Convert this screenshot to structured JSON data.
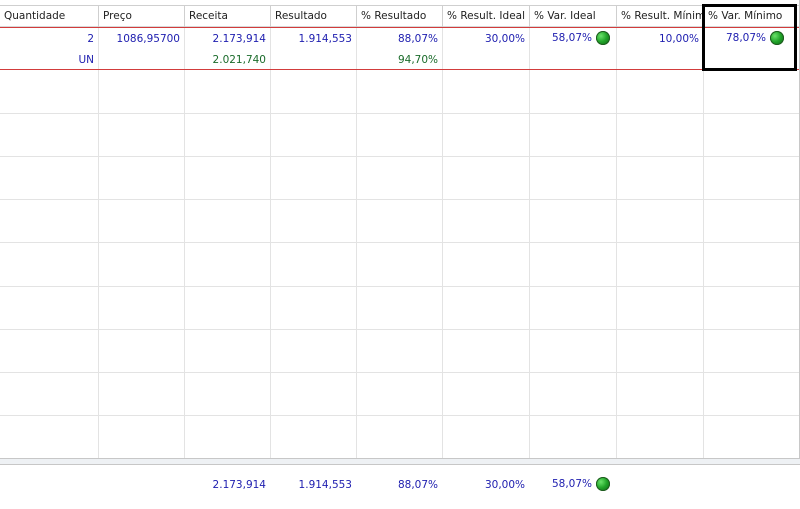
{
  "columns": [
    {
      "key": "qty",
      "label": "Quantidade"
    },
    {
      "key": "price",
      "label": "Preço"
    },
    {
      "key": "revenue",
      "label": "Receita"
    },
    {
      "key": "result",
      "label": "Resultado"
    },
    {
      "key": "pct_result",
      "label": "% Resultado"
    },
    {
      "key": "pct_ideal",
      "label": "% Result. Ideal"
    },
    {
      "key": "var_ideal",
      "label": "% Var. Ideal"
    },
    {
      "key": "pct_min",
      "label": "% Result. Mínimo"
    },
    {
      "key": "var_min",
      "label": "% Var. Mínimo"
    }
  ],
  "row1": {
    "qty": "2",
    "price": "1086,95700",
    "revenue": "2.173,914",
    "result": "1.914,553",
    "pct_result": "88,07%",
    "pct_ideal": "30,00%",
    "var_ideal": "58,07%",
    "pct_min": "10,00%",
    "var_min": "78,07%"
  },
  "row2": {
    "qty": "UN",
    "revenue": "2.021,740",
    "pct_result": "94,70%"
  },
  "totals": {
    "revenue": "2.173,914",
    "result": "1.914,553",
    "pct_result": "88,07%",
    "pct_ideal": "30,00%",
    "var_ideal": "58,07%"
  },
  "colors": {
    "value_blue": "#2020b0",
    "value_green": "#1a6b2a",
    "row_separator_red": "#d23c3c",
    "status_dot": "#22a52a",
    "highlight_box": "#000000"
  },
  "icons": {
    "status": "green-status-dot-icon"
  }
}
